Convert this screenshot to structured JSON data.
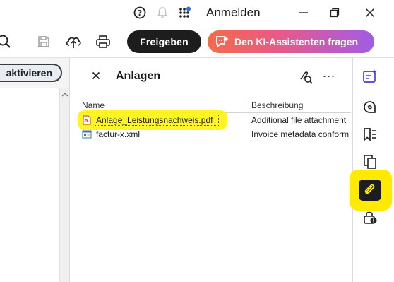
{
  "titlebar": {
    "signin_label": "Anmelden",
    "icons": [
      "help-icon",
      "notifications-icon",
      "apps-icon",
      "minimize-icon",
      "restore-icon",
      "close-icon"
    ]
  },
  "toolbar": {
    "share_label": "Freigeben",
    "ai_label": "Den KI-Assistenten fragen"
  },
  "left_pane": {
    "activate_label": "aktivieren"
  },
  "attachments_panel": {
    "title": "Anlagen",
    "columns": {
      "name": "Name",
      "description": "Beschreibung"
    },
    "rows": [
      {
        "name": "Anlage_Leistungsnachweis.pdf",
        "description": "Additional file attachment",
        "icon": "pdf-file-icon",
        "selected": true
      },
      {
        "name": "factur-x.xml",
        "description": "Invoice metadata conform",
        "icon": "xml-file-icon",
        "selected": false
      }
    ]
  },
  "right_rail": {
    "icons": [
      "ai-edit-icon",
      "comment-icon",
      "bookmark-icon",
      "pages-icon",
      "attachment-icon",
      "security-icon"
    ],
    "active": "attachment-icon"
  },
  "colors": {
    "highlight": "#fff200",
    "share_button_bg": "#1d1d1d",
    "ai_gradient_start": "#f36b4a",
    "ai_gradient_end": "#a05ce6",
    "rail_accent": "#4a3fd8"
  }
}
